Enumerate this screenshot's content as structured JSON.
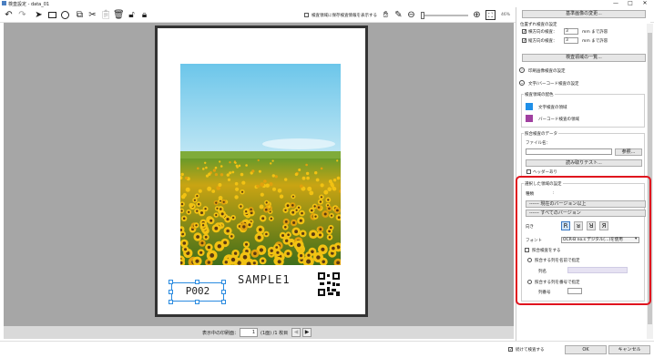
{
  "window": {
    "title": "検査設定 - data_01",
    "controls": [
      "—",
      "□",
      "✕"
    ]
  },
  "toolbar": {
    "icons": [
      "undo-icon",
      "redo-icon",
      "pointer-icon",
      "rectangle-icon",
      "ellipse-icon",
      "copy-icon",
      "cut-icon",
      "paste-icon",
      "delete-icon",
      "unlock-icon",
      "lock-icon"
    ],
    "show_other_check_label": "検査領域に保存検査情報を表示する",
    "zoom_label": "46%"
  },
  "canvas": {
    "sample_text": "SAMPLE1",
    "selected_text": "P002"
  },
  "pager": {
    "label": "表示中の印刷面：",
    "page_value": "1",
    "page_info": "(1面) /1 枚目"
  },
  "panel": {
    "reference_button": "基準画像の変更...",
    "tilt_section_label": "位置ずれ検査の設定",
    "tilt_x_label": "横方向の検査：",
    "tilt_x_value": "3",
    "tilt_x_unit": "mm まで許容",
    "tilt_y_label": "縦方向の検査：",
    "tilt_y_value": "3",
    "tilt_y_unit": "mm まで許容",
    "region_list_button": "検査領域の一覧...",
    "print_area_label": "印刷画像検査の設定",
    "text_barcode_label": "文字/バーコード検査の設定",
    "region_color_group": "検査領域の配色",
    "text_region_label": "文字検査の領域",
    "barcode_region_label": "バーコード検査の領域",
    "text_color": "#1f8fe8",
    "barcode_color": "#a040a0",
    "compare_group": "照合検査のデータ",
    "file_label": "ファイル名：",
    "browse_button": "参照...",
    "import_button": "読み取りテスト...",
    "header_check_label": "ヘッダーあり",
    "selected_region_group": "選択した領域の設定",
    "type_label": "種類",
    "type_option_1": "------ 現在のバージョン以上",
    "type_option_2": "------ すべてのバージョン",
    "direction_label": "向き",
    "font_label": "フォント",
    "font_value": "OCR-B no.s デジタル(…)を使用",
    "compare_check_label": "照合検査をする",
    "compare_opt1_label": "照合する列を名前で指定",
    "column_name_label": "列名",
    "compare_opt2_label": "照合する列を番号で指定",
    "column_number_label": "列番号"
  },
  "footer": {
    "finish_check_label": "続けて検査する",
    "ok_label": "OK",
    "cancel_label": "キャンセル"
  }
}
